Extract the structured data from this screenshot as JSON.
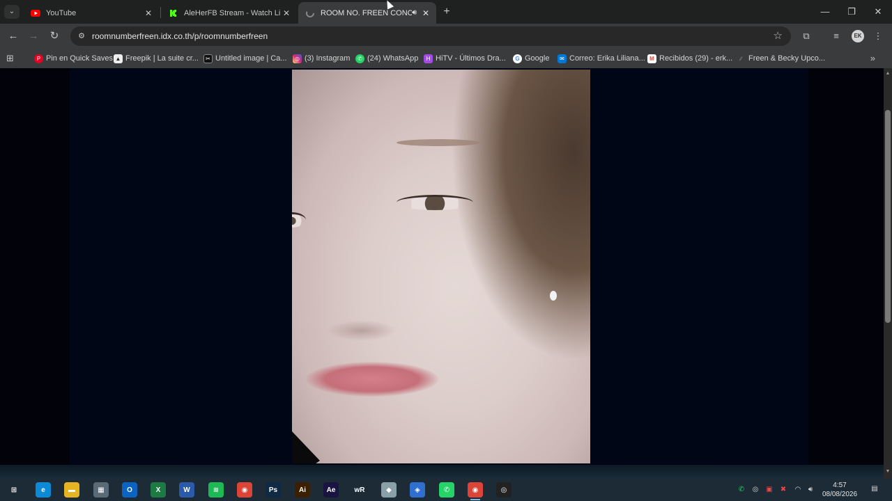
{
  "tabs": [
    {
      "title": "YouTube",
      "favicon": "youtube-icon",
      "color": "#ff0000",
      "active": false
    },
    {
      "title": "AleHerFB Stream - Watch Live o",
      "favicon": "kick-icon",
      "color": "#53fc18",
      "active": false
    },
    {
      "title": "ROOM NO. FREEN CONCEF",
      "favicon": "loading-icon",
      "color": "#888888",
      "active": true
    }
  ],
  "address_bar": {
    "url": "roomnumberfreen.idx.co.th/p/roomnumberfreen"
  },
  "bookmarks": [
    {
      "label": "Pin en Quick Saves",
      "icon": "pinterest-icon",
      "color": "#e60023"
    },
    {
      "label": "Freepik | La suite cr...",
      "icon": "freepik-icon",
      "color": "#ffffff"
    },
    {
      "label": "Untitled image | Ca...",
      "icon": "capcut-icon",
      "color": "#000000"
    },
    {
      "label": "(3) Instagram",
      "icon": "instagram-icon",
      "color": "#d62976"
    },
    {
      "label": "(24) WhatsApp",
      "icon": "whatsapp-icon",
      "color": "#25d366"
    },
    {
      "label": "HiTV - Últimos Dra...",
      "icon": "hitv-icon",
      "color": "#a349e6"
    },
    {
      "label": "Google",
      "icon": "google-icon",
      "color": "#4285f4"
    },
    {
      "label": "Correo: Erika Liliana...",
      "icon": "outlook-icon",
      "color": "#0078d4"
    },
    {
      "label": "Recibidos (29) - erk...",
      "icon": "gmail-icon",
      "color": "#ea4335"
    },
    {
      "label": "Freen & Becky Upco...",
      "icon": "link-icon",
      "color": "#888888"
    }
  ],
  "taskbar": {
    "apps": [
      {
        "name": "start",
        "glyph": "⊞",
        "color": "#1c2b36"
      },
      {
        "name": "edge",
        "glyph": "e",
        "color": "#0c8ad6"
      },
      {
        "name": "file-explorer",
        "glyph": "▬",
        "color": "#e6b422"
      },
      {
        "name": "calculator",
        "glyph": "▦",
        "color": "#5a6a76"
      },
      {
        "name": "outlook",
        "glyph": "O",
        "color": "#0a64c0"
      },
      {
        "name": "excel",
        "glyph": "X",
        "color": "#1d7a43"
      },
      {
        "name": "word",
        "glyph": "W",
        "color": "#2b5aa8"
      },
      {
        "name": "spotify",
        "glyph": "≋",
        "color": "#1db954"
      },
      {
        "name": "chrome",
        "glyph": "◉",
        "color": "#db4437"
      },
      {
        "name": "photoshop",
        "glyph": "Ps",
        "color": "#0f2a44"
      },
      {
        "name": "illustrator",
        "glyph": "Ai",
        "color": "#3a1f00"
      },
      {
        "name": "after-effects",
        "glyph": "Ae",
        "color": "#1a1440"
      },
      {
        "name": "wr",
        "glyph": "wR",
        "color": "#1c2b36"
      },
      {
        "name": "app-bird",
        "glyph": "◆",
        "color": "#8aa0a8"
      },
      {
        "name": "app-blue",
        "glyph": "◈",
        "color": "#2f6fd0"
      },
      {
        "name": "whatsapp",
        "glyph": "✆",
        "color": "#25d366"
      },
      {
        "name": "chrome-active",
        "glyph": "◉",
        "color": "#db4437"
      },
      {
        "name": "obs",
        "glyph": "◎",
        "color": "#222222"
      }
    ],
    "clock_time": "4:57",
    "clock_date": "08/08/2026"
  }
}
